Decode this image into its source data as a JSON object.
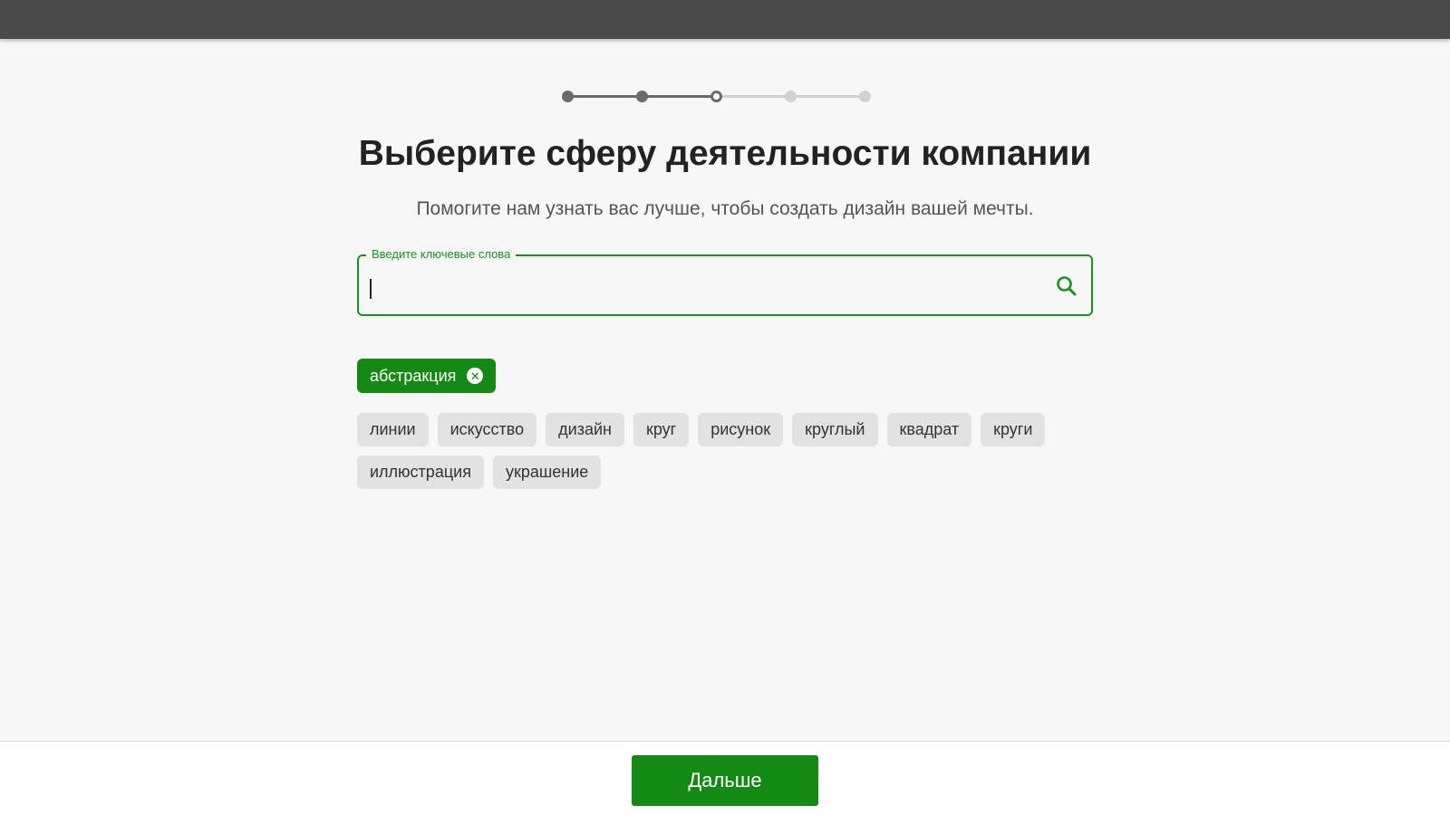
{
  "stepper": {
    "total_steps": 5,
    "completed_steps": 2,
    "current_step": 3
  },
  "header": {
    "title": "Выберите сферу деятельности компании",
    "subtitle": "Помогите нам узнать вас лучше, чтобы создать дизайн вашей мечты."
  },
  "search": {
    "label": "Введите ключевые слова",
    "value": ""
  },
  "selected_tags": [
    {
      "label": "абстракция",
      "remove_icon": "close-circle-icon"
    }
  ],
  "suggested_tags": [
    "линии",
    "искусство",
    "дизайн",
    "круг",
    "рисунок",
    "круглый",
    "квадрат",
    "круги",
    "иллюстрация",
    "украшение"
  ],
  "footer": {
    "next_label": "Дальше"
  },
  "colors": {
    "accent": "#148a14",
    "topbar": "#4a4a4a",
    "chip_bg": "#e2e2e2",
    "stepper_done": "#6a6a6a",
    "stepper_pending": "#d2d2d2"
  }
}
